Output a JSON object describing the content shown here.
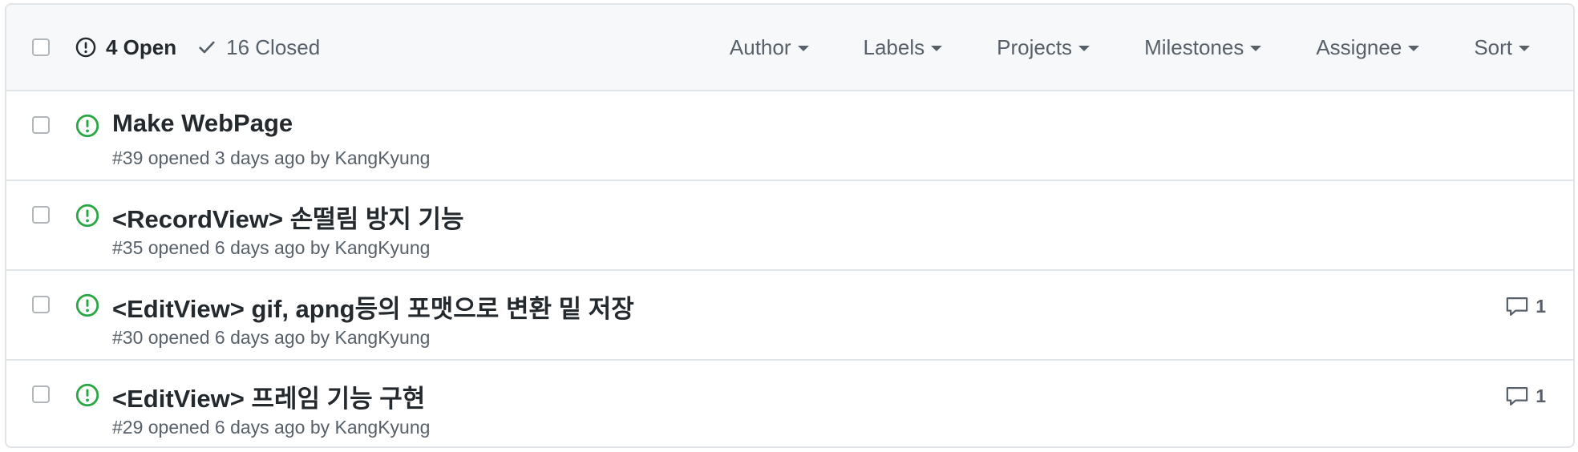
{
  "header": {
    "open_label": "4 Open",
    "closed_label": "16 Closed",
    "filters": [
      "Author",
      "Labels",
      "Projects",
      "Milestones",
      "Assignee",
      "Sort"
    ]
  },
  "issues": [
    {
      "title": "Make WebPage",
      "meta": "#39 opened 3 days ago by KangKyung",
      "comments": ""
    },
    {
      "title": "<RecordView> 손떨림 방지 기능",
      "meta": "#35 opened 6 days ago by KangKyung",
      "comments": ""
    },
    {
      "title": "<EditView> gif, apng등의 포맷으로 변환 밑 저장",
      "meta": "#30 opened 6 days ago by KangKyung",
      "comments": "1"
    },
    {
      "title": "<EditView> 프레임 기능 구현",
      "meta": "#29 opened 6 days ago by KangKyung",
      "comments": "1"
    }
  ],
  "colors": {
    "open_green": "#28a745",
    "text": "#24292e",
    "muted": "#586069",
    "border": "#e1e4e8"
  }
}
